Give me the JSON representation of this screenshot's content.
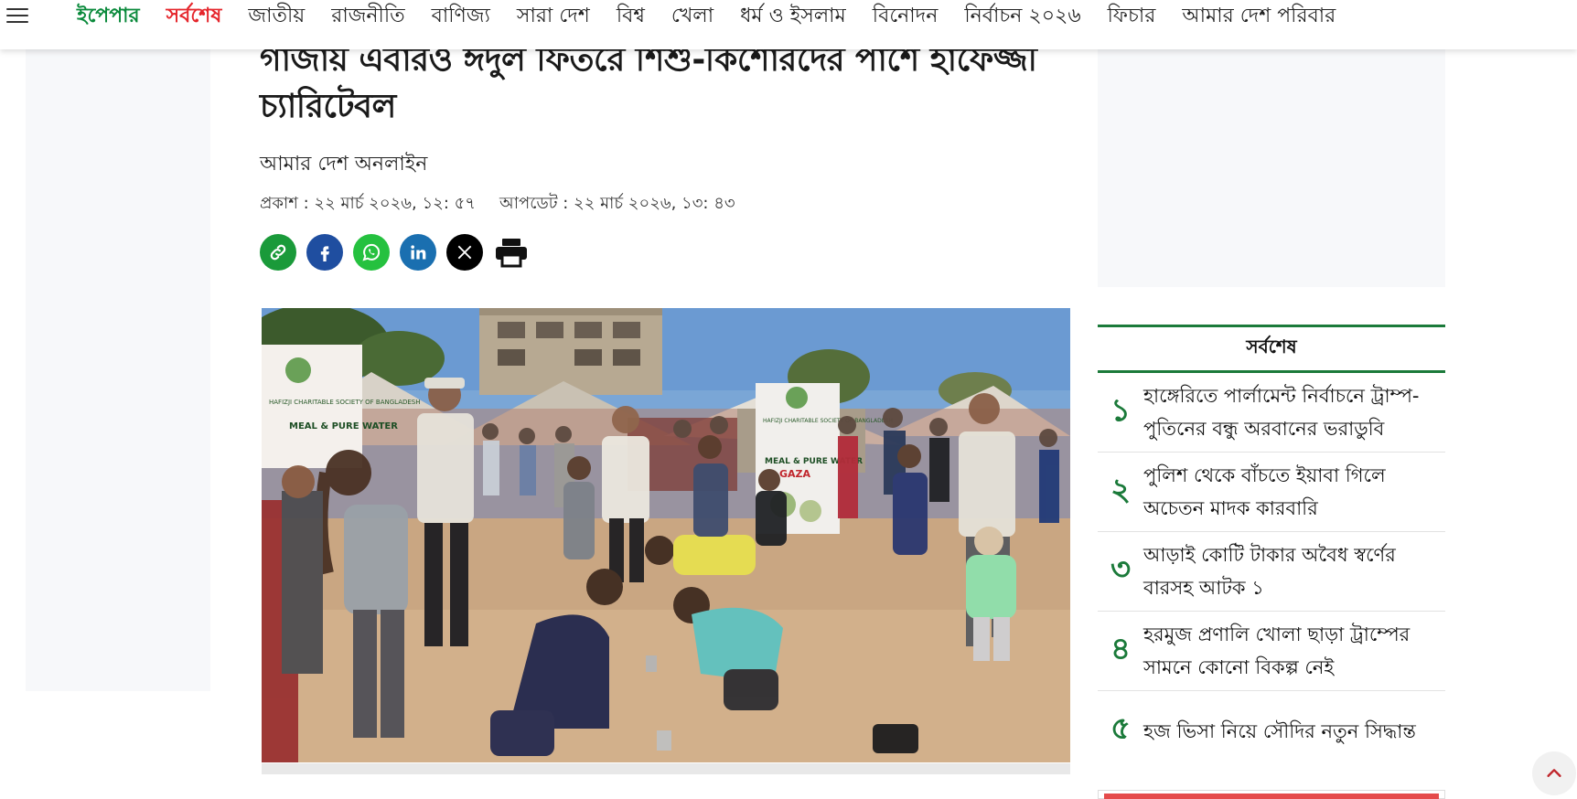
{
  "nav": {
    "items": [
      {
        "label": "ইপেপার",
        "style": "green"
      },
      {
        "label": "সর্বশেষ",
        "style": "red"
      },
      {
        "label": "জাতীয়",
        "style": ""
      },
      {
        "label": "রাজনীতি",
        "style": ""
      },
      {
        "label": "বাণিজ্য",
        "style": ""
      },
      {
        "label": "সারা দেশ",
        "style": ""
      },
      {
        "label": "বিশ্ব",
        "style": ""
      },
      {
        "label": "খেলা",
        "style": ""
      },
      {
        "label": "ধর্ম ও ইসলাম",
        "style": ""
      },
      {
        "label": "বিনোদন",
        "style": ""
      },
      {
        "label": "নির্বাচন ২০২৬",
        "style": ""
      },
      {
        "label": "ফিচার",
        "style": ""
      },
      {
        "label": "আমার দেশ পরিবার",
        "style": ""
      }
    ]
  },
  "article": {
    "headline": "গাজায় এবারও ঈদুল ফিতরে শিশু-কিশোরদের পাশে হাফেজ্জী চ্যারিটেবল",
    "author": "আমার দেশ অনলাইন",
    "published": "প্রকাশ : ২২ মার্চ ২০২৬, ১২: ৫৭",
    "updated": "আপডেট : ২২ মার্চ ২০২৬, ১৩: ৪৩"
  },
  "share": {
    "icons": [
      "link-icon",
      "facebook-icon",
      "whatsapp-icon",
      "linkedin-icon",
      "x-icon",
      "print-icon"
    ]
  },
  "photo": {
    "banner_left_top": "HAFIZJI CHARITABLE SOCIETY OF BANGLADESH",
    "banner_left_mid": "MEAL & PURE WATER",
    "banner_right_top": "HAFIZJI CHARITABLE SOCIETY OF BANGLADESH",
    "banner_right_mid": "MEAL & PURE WATER",
    "banner_right_place": "GAZA"
  },
  "latest": {
    "heading": "সর্বশেষ",
    "items": [
      {
        "num": "১",
        "title": "হাঙ্গেরিতে পার্লামেন্ট নির্বাচনে ট্রাম্প-পুতিনের বন্ধু অরবানের ভরাডুবি"
      },
      {
        "num": "২",
        "title": "পুলিশ থেকে বাঁচতে ইয়াবা গিলে অচেতন মাদক কারবারি"
      },
      {
        "num": "৩",
        "title": "আড়াই কোটি টাকার অবৈধ স্বর্ণের বারসহ আটক ১"
      },
      {
        "num": "৪",
        "title": "হরমুজ প্রণালি খোলা ছাড়া ট্রাম্পের সামনে কোনো বিকল্প নেই"
      },
      {
        "num": "৫",
        "title": "হজ ভিসা নিয়ে সৌদির নতুন সিদ্ধান্ত"
      }
    ]
  },
  "colors": {
    "brand_green": "#1b7a3a",
    "accent_red": "#e5262c"
  }
}
